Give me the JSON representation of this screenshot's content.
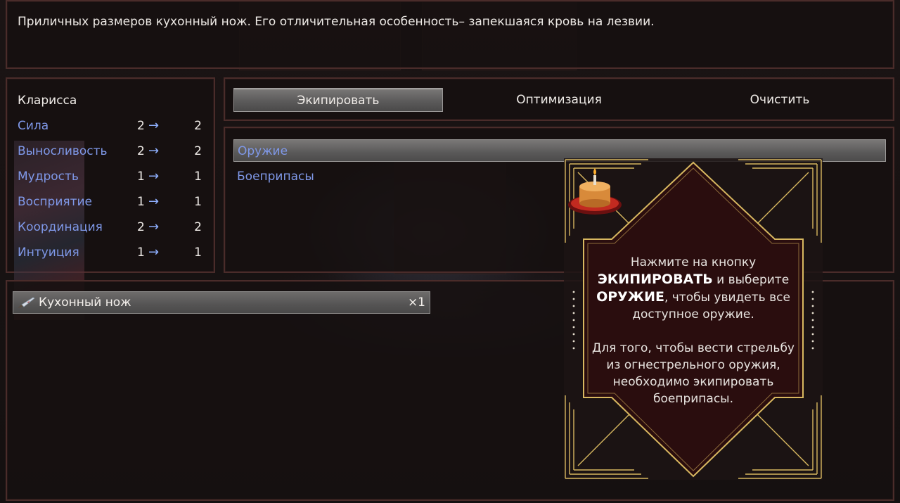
{
  "help": {
    "text": "Приличных размеров кухонный нож. Его отличительная особенность– запекшаяся кровь на лезвии."
  },
  "actor": {
    "name": "Кларисса",
    "stats": [
      {
        "label": "Сила",
        "current": "2",
        "new": "2"
      },
      {
        "label": "Выносливость",
        "current": "2",
        "new": "2"
      },
      {
        "label": "Мудрость",
        "current": "1",
        "new": "1"
      },
      {
        "label": "Восприятие",
        "current": "1",
        "new": "1"
      },
      {
        "label": "Координация",
        "current": "2",
        "new": "2"
      },
      {
        "label": "Интуиция",
        "current": "1",
        "new": "1"
      }
    ],
    "arrow": "→"
  },
  "commands": [
    {
      "label": "Экипировать",
      "selected": true
    },
    {
      "label": "Оптимизация",
      "selected": false
    },
    {
      "label": "Очистить",
      "selected": false
    }
  ],
  "slots": [
    {
      "label": "Оружие",
      "selected": true
    },
    {
      "label": "Боеприпасы",
      "selected": false
    }
  ],
  "items": [
    {
      "name": "Кухонный нож",
      "count": "×1",
      "icon": "knife-icon"
    }
  ],
  "tutorial": {
    "icon": "cake-icon",
    "line1": "Нажмите на кнопку",
    "bold1": "ЭКИПИРОВАТЬ",
    "line2": " и выберите",
    "bold2": "ОРУЖИЕ",
    "line3": ", чтобы увидеть все доступное оружие.",
    "para2": "Для того, чтобы вести стрельбу из огнестрельного оружия, необходимо экипировать боеприпасы."
  },
  "colors": {
    "system_blue": "#7f98e8",
    "frame_border": "#4a2c2a",
    "card_gold": "#d8b860",
    "card_bg": "#2a0d0e"
  }
}
